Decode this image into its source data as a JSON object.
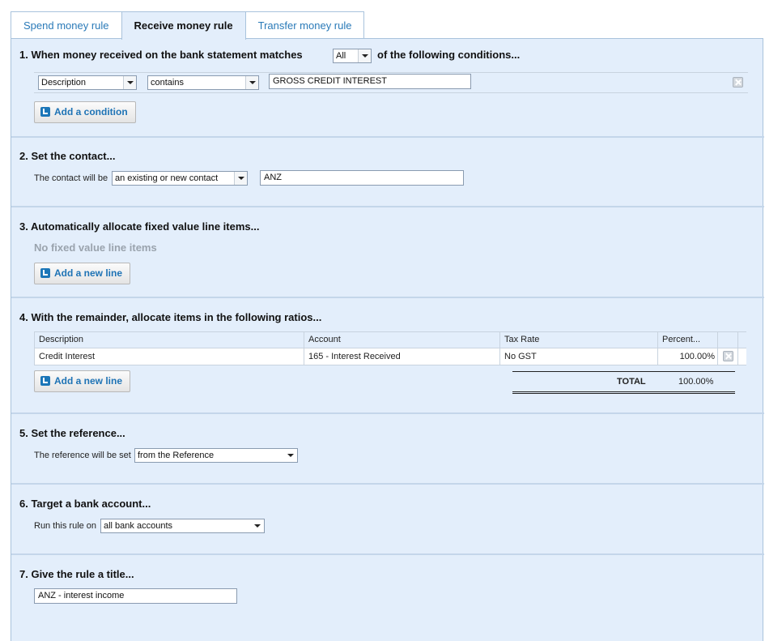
{
  "tabs": [
    {
      "label": "Spend money rule",
      "active": false
    },
    {
      "label": "Receive money rule",
      "active": true
    },
    {
      "label": "Transfer money rule",
      "active": false
    }
  ],
  "section1": {
    "heading_pre": "1.  When money received on the bank statement matches",
    "match_select": "All",
    "heading_post": "of the following conditions...",
    "condition": {
      "field": "Description",
      "operator": "contains",
      "value": "GROSS CREDIT  INTEREST"
    },
    "add_condition_label": "Add a condition"
  },
  "section2": {
    "heading": "2.  Set the contact...",
    "label": "The contact will be",
    "contact_type": "an existing or new contact",
    "contact_value": "ANZ"
  },
  "section3": {
    "heading": "3.  Automatically allocate fixed value line items...",
    "empty_text": "No fixed value line items",
    "add_line_label": "Add a new line"
  },
  "section4": {
    "heading": "4.  With the remainder, allocate items in the following ratios...",
    "columns": [
      "Description",
      "Account",
      "Tax Rate",
      "Percent..."
    ],
    "rows": [
      {
        "description": "Credit Interest",
        "account": "165 - Interest Received",
        "tax_rate": "No GST",
        "percent": "100.00%"
      }
    ],
    "add_line_label": "Add a new line",
    "total_label": "TOTAL",
    "total_value": "100.00%"
  },
  "section5": {
    "heading": "5.  Set the reference...",
    "label": "The reference will be set",
    "value": "from the Reference"
  },
  "section6": {
    "heading": "6.  Target a bank account...",
    "label": "Run this rule on",
    "value": "all bank accounts"
  },
  "section7": {
    "heading": "7.  Give the rule a title...",
    "value": "ANZ - interest income"
  },
  "icons": {
    "plus": "add-icon",
    "remove": "remove-icon",
    "dropdown": "chevron-down-icon"
  },
  "colors": {
    "panel_bg": "#e3eefb",
    "link_blue": "#2a7ab8",
    "button_blue": "#1e73b5"
  }
}
